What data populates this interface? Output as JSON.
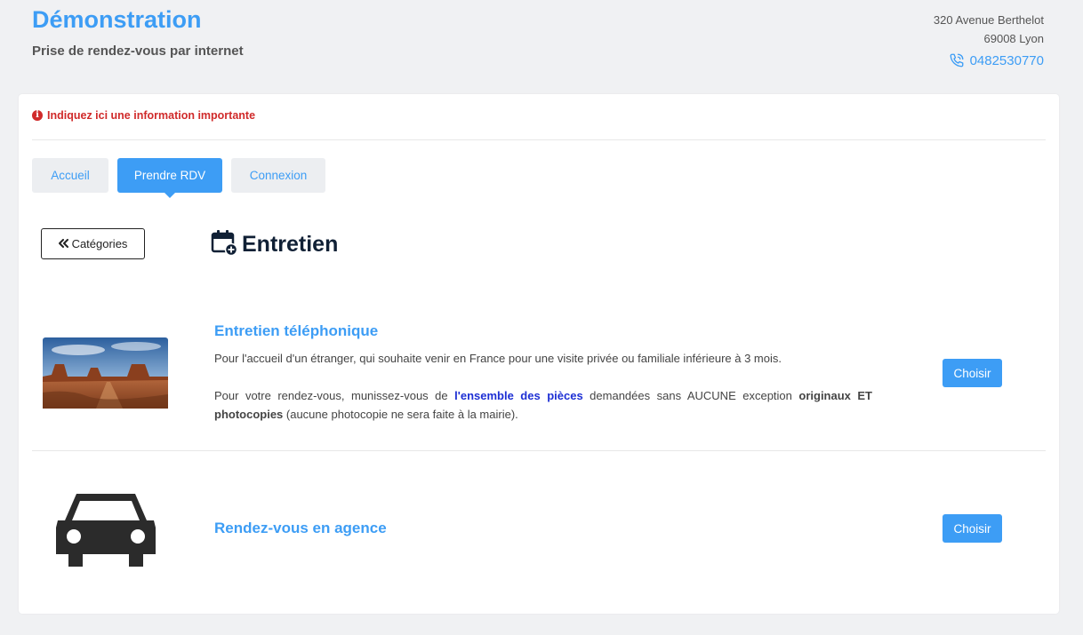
{
  "header": {
    "title": "Démonstration",
    "subtitle": "Prise de rendez-vous par internet",
    "address_line1": "320 Avenue Berthelot",
    "address_line2": "69008 Lyon",
    "phone": "0482530770"
  },
  "notice": {
    "text": "Indiquez ici une information importante"
  },
  "tabs": [
    {
      "label": "Accueil"
    },
    {
      "label": "Prendre RDV"
    },
    {
      "label": "Connexion"
    }
  ],
  "back_button": {
    "label": "Catégories"
  },
  "page_heading": "Entretien",
  "services": [
    {
      "title": "Entretien téléphonique",
      "desc_line1": "Pour l'accueil d'un étranger, qui souhaite venir en France pour une visite privée ou familiale inférieure à 3 mois.",
      "desc_part1": "Pour votre rendez-vous, munissez-vous de ",
      "desc_highlight": "l'ensemble des pièces",
      "desc_part2": " demandées sans AUCUNE exception ",
      "desc_bold": "originaux ET photocopies",
      "desc_part3": " (aucune photocopie ne sera faite à la mairie).",
      "button": "Choisir",
      "icon": "landscape-thumbnail"
    },
    {
      "title": "Rendez-vous en agence",
      "button": "Choisir",
      "icon": "car-icon"
    }
  ],
  "colors": {
    "accent": "#3d9df5",
    "alert": "#d02a2a",
    "heading": "#102035"
  }
}
